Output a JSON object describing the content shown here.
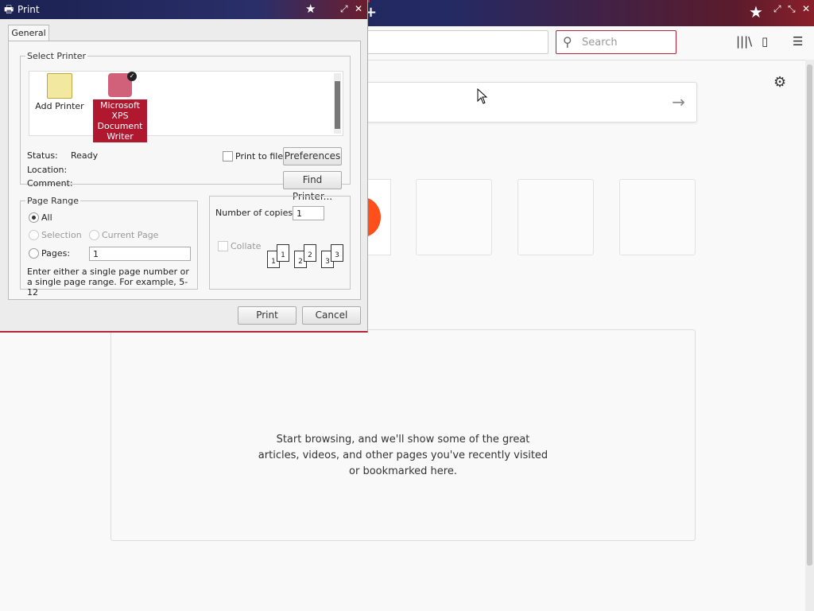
{
  "browser": {
    "search_placeholder": "Search",
    "highlights_message": "Start browsing, and we'll show some of the great articles, videos, and other pages you've recently visited or bookmarked here.",
    "icons": [
      "library-icon",
      "sidebar-icon",
      "menu-icon",
      "gear-icon",
      "arrow-right-icon",
      "search-icon"
    ]
  },
  "print_dialog": {
    "title": "Print",
    "tab": "General",
    "select_printer": {
      "legend": "Select Printer",
      "printers": [
        {
          "label": "Add Printer",
          "selected": false
        },
        {
          "label": "Microsoft XPS Document Writer",
          "selected": true
        }
      ]
    },
    "status_label": "Status:",
    "status_value": "Ready",
    "location_label": "Location:",
    "comment_label": "Comment:",
    "print_to_file": "Print to file",
    "preferences_button": "Preferences",
    "find_printer_button": "Find Printer...",
    "page_range": {
      "legend": "Page Range",
      "all": "All",
      "selection": "Selection",
      "current_page": "Current Page",
      "pages": "Pages:",
      "pages_value": "1",
      "hint": "Enter either a single page number or a single page range.  For example, 5-12"
    },
    "copies": {
      "label": "Number of copies:",
      "value": "1",
      "collate": "Collate"
    },
    "print_button": "Print",
    "cancel_button": "Cancel"
  }
}
